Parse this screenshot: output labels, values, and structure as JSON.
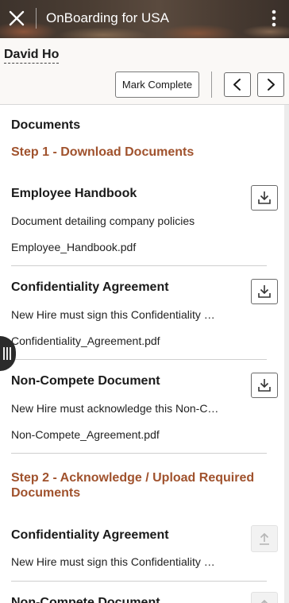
{
  "header": {
    "title": "OnBoarding for USA",
    "close_icon": "close-icon",
    "menu_icon": "kebab-menu-icon"
  },
  "person": {
    "name": "David Ho"
  },
  "toolbar": {
    "mark_complete_label": "Mark Complete",
    "prev_icon": "chevron-left-icon",
    "next_icon": "chevron-right-icon"
  },
  "content": {
    "heading": "Documents",
    "step1": {
      "title": "Step 1 - Download Documents",
      "items": [
        {
          "title": "Employee Handbook",
          "description": "Document detailing company policies",
          "file": "Employee_Handbook.pdf"
        },
        {
          "title": "Confidentiality Agreement",
          "description": "New Hire must sign this Confidentiality …",
          "file": "Confidentiality_Agreement.pdf"
        },
        {
          "title": "Non-Compete Document",
          "description": "New Hire must acknowledge this Non-C…",
          "file": "Non-Compete_Agreement.pdf"
        }
      ]
    },
    "step2": {
      "title": "Step 2 - Acknowledge / Upload Required Documents",
      "items": [
        {
          "title": "Confidentiality Agreement",
          "description": "New Hire must sign this Confidentiality …"
        },
        {
          "title": "Non-Compete Document"
        }
      ]
    }
  },
  "colors": {
    "step_heading": "#a0522d",
    "banner": "#4a3d33"
  }
}
